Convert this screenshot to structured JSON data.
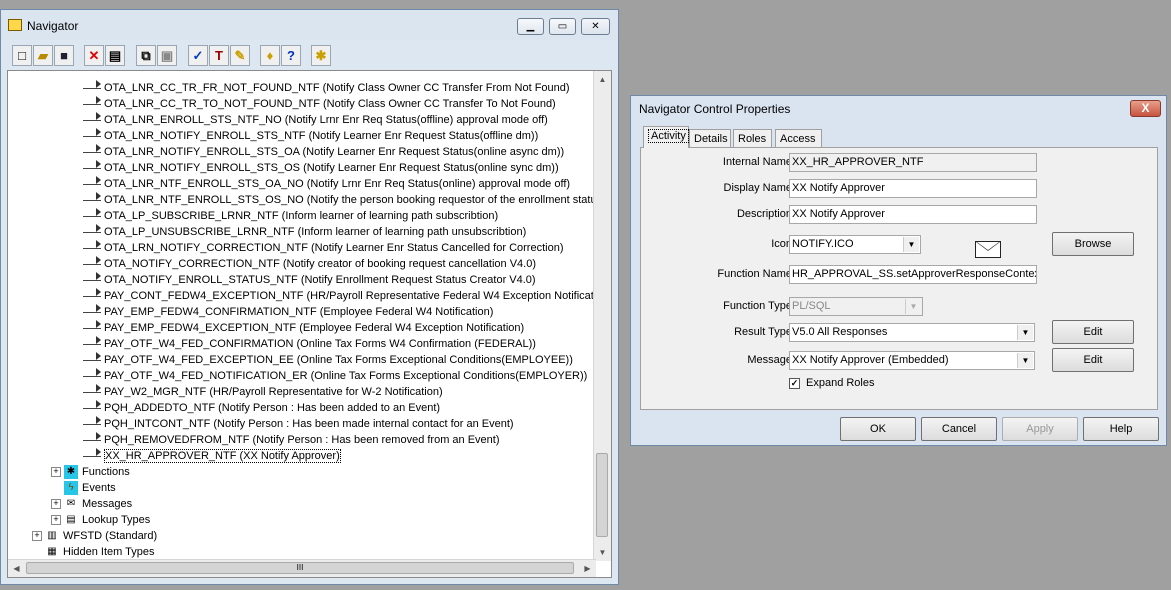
{
  "navigator": {
    "title": "Navigator",
    "tree_items": [
      "OTA_LNR_CC_TR_FR_NOT_FOUND_NTF (Notify Class Owner CC Transfer From Not Found)",
      "OTA_LNR_CC_TR_TO_NOT_FOUND_NTF (Notify Class Owner CC Transfer To Not Found)",
      "OTA_LNR_ENROLL_STS_NTF_NO (Notify Lrnr Enr Req Status(offline) approval mode off)",
      "OTA_LNR_NOTIFY_ENROLL_STS_NTF (Notify Learner Enr Request Status(offline dm))",
      "OTA_LNR_NOTIFY_ENROLL_STS_OA (Notify Learner Enr Request Status(online async dm))",
      "OTA_LNR_NOTIFY_ENROLL_STS_OS (Notify  Learner Enr Request Status(online sync dm))",
      "OTA_LNR_NTF_ENROLL_STS_OA_NO (Notify Lrnr Enr Req Status(online) approval mode off)",
      "OTA_LNR_NTF_ENROLL_STS_OS_NO (Notify the person booking requestor of the enrollment status)",
      "OTA_LP_SUBSCRIBE_LRNR_NTF (Inform learner of learning path subscribtion)",
      "OTA_LP_UNSUBSCRIBE_LRNR_NTF (Inform learner of learning path unsubscribtion)",
      "OTA_LRN_NOTIFY_CORRECTION_NTF (Notify Learner Enr Status Cancelled for Correction)",
      "OTA_NOTIFY_CORRECTION_NTF (Notify creator of booking request cancellation V4.0)",
      "OTA_NOTIFY_ENROLL_STATUS_NTF (Notify Enrollment Request Status Creator V4.0)",
      "PAY_CONT_FEDW4_EXCEPTION_NTF (HR/Payroll Representative Federal W4 Exception Notificatio",
      "PAY_EMP_FEDW4_CONFIRMATION_NTF (Employee Federal W4 Notification)",
      "PAY_EMP_FEDW4_EXCEPTION_NTF (Employee Federal W4 Exception Notification)",
      "PAY_OTF_W4_FED_CONFIRMATION (Online Tax Forms W4 Confirmation (FEDERAL))",
      "PAY_OTF_W4_FED_EXCEPTION_EE (Online Tax Forms Exceptional Conditions(EMPLOYEE))",
      "PAY_OTF_W4_FED_NOTIFICATION_ER (Online Tax Forms Exceptional Conditions(EMPLOYER))",
      "PAY_W2_MGR_NTF (HR/Payroll Representative for W-2 Notification)",
      "PQH_ADDEDTO_NTF (Notify Person : Has been added to an Event)",
      "PQH_INTCONT_NTF (Notify Person : Has been made internal contact for an Event)",
      "PQH_REMOVEDFROM_NTF (Notify Person : Has been removed from an Event)",
      "XX_HR_APPROVER_NTF (XX Notify Approver)"
    ],
    "groups": {
      "functions": "Functions",
      "events": "Events",
      "messages": "Messages",
      "lookup_types": "Lookup Types"
    },
    "item_types": {
      "wfstd": "WFSTD (Standard)",
      "hidden": "Hidden Item Types"
    },
    "scroll_grip": "III"
  },
  "dialog": {
    "title": "Navigator Control Properties",
    "close": "X",
    "tabs": [
      "Activity",
      "Details",
      "Roles",
      "Access"
    ],
    "labels": {
      "internal_name": "Internal Name",
      "display_name": "Display Name",
      "description": "Description",
      "icon": "Icon",
      "function_name": "Function Name",
      "function_type": "Function Type",
      "result_type": "Result Type",
      "message": "Message"
    },
    "values": {
      "internal_name": "XX_HR_APPROVER_NTF",
      "display_name": "XX Notify Approver",
      "description": "XX Notify Approver",
      "icon": "NOTIFY.ICO",
      "function_name": "HR_APPROVAL_SS.setApproverResponseContext",
      "function_type": "PL/SQL",
      "result_type": "V5.0 All Responses",
      "message": "XX Notify Approver (Embedded)"
    },
    "expand_roles": "Expand Roles",
    "buttons": {
      "browse": "Browse",
      "edit_result": "Edit",
      "edit_message": "Edit",
      "ok": "OK",
      "cancel": "Cancel",
      "apply": "Apply",
      "help": "Help"
    }
  }
}
